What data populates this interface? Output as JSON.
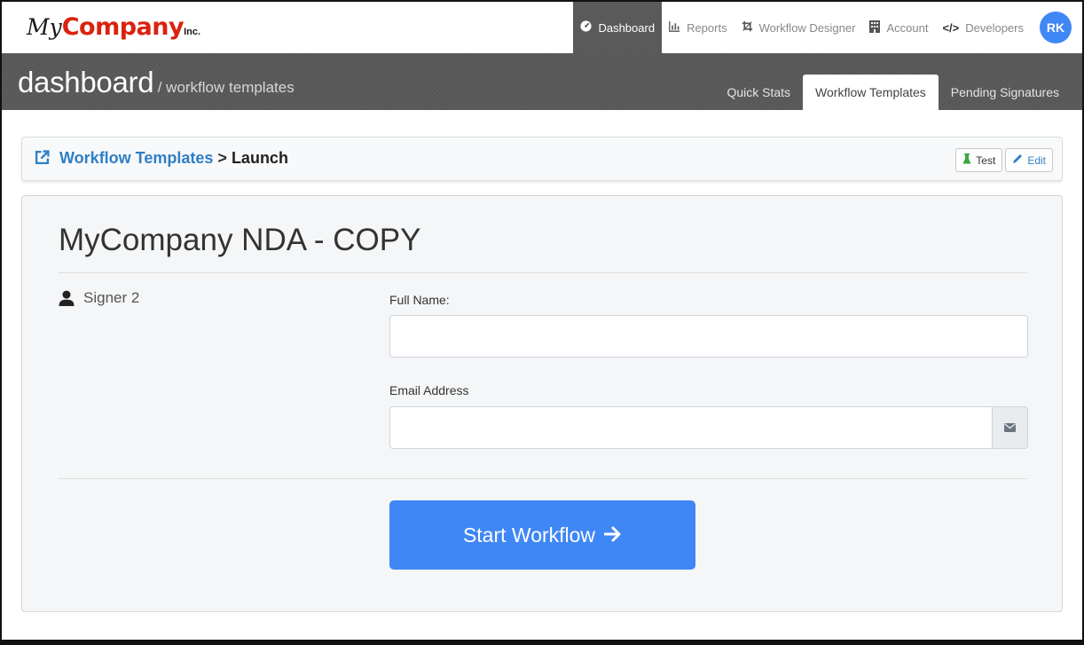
{
  "brand": {
    "my": "My",
    "company": "Company",
    "inc": "Inc."
  },
  "nav": {
    "items": [
      {
        "label": "Dashboard",
        "icon": "dashboard-gauge-icon",
        "active": true
      },
      {
        "label": "Reports",
        "icon": "bar-chart-icon"
      },
      {
        "label": "Workflow Designer",
        "icon": "crop-tool-icon"
      },
      {
        "label": "Account",
        "icon": "building-icon"
      },
      {
        "label": "Developers",
        "icon": "code-brackets-icon"
      }
    ],
    "avatar_initials": "RK"
  },
  "header": {
    "title": "dashboard",
    "subtitle": "/ workflow templates",
    "tabs": [
      {
        "label": "Quick Stats"
      },
      {
        "label": "Workflow Templates",
        "active": true
      },
      {
        "label": "Pending Signatures"
      }
    ]
  },
  "breadcrumb": {
    "icon": "external-link-icon",
    "link_label": "Workflow Templates",
    "separator": ">",
    "current": "Launch",
    "test_label": "Test",
    "edit_label": "Edit"
  },
  "form": {
    "title": "MyCompany NDA - COPY",
    "signer_label": "Signer 2",
    "full_name_label": "Full Name:",
    "full_name_value": "",
    "email_label": "Email Address",
    "email_value": "",
    "email_icon": "envelope-icon",
    "submit_label": "Start Workflow",
    "submit_icon": "arrow-right-icon"
  },
  "colors": {
    "accent": "#3f87f5",
    "brand_red": "#d9230f",
    "link_blue": "#2f7fc6",
    "header_gray": "#5a5a5a"
  }
}
